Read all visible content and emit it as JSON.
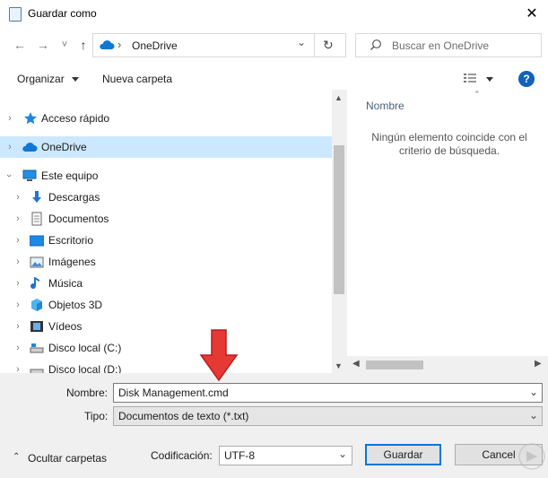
{
  "window": {
    "title": "Guardar como",
    "close_glyph": "✕"
  },
  "nav": {
    "back": "←",
    "forward": "→",
    "recent": "˅",
    "up": "↑",
    "refresh": "↻",
    "chevron": "›",
    "dropdown": "⌄"
  },
  "address": {
    "location": "OneDrive"
  },
  "search": {
    "placeholder": "Buscar en OneDrive"
  },
  "toolbar": {
    "organize": "Organizar",
    "new_folder": "Nueva carpeta",
    "help": "?"
  },
  "tree": [
    {
      "label": "Acceso rápido",
      "icon": "star-icon",
      "expandable": true,
      "indent": 0
    },
    {
      "label": "OneDrive",
      "icon": "cloud-icon",
      "expandable": true,
      "indent": 0,
      "selected": true
    },
    {
      "label": "Este equipo",
      "icon": "computer-icon",
      "expandable": true,
      "expanded": true,
      "indent": 0
    },
    {
      "label": "Descargas",
      "icon": "download-icon",
      "expandable": true,
      "indent": 1
    },
    {
      "label": "Documentos",
      "icon": "document-icon",
      "expandable": true,
      "indent": 1
    },
    {
      "label": "Escritorio",
      "icon": "desktop-icon",
      "expandable": true,
      "indent": 1
    },
    {
      "label": "Imágenes",
      "icon": "image-icon",
      "expandable": true,
      "indent": 1
    },
    {
      "label": "Música",
      "icon": "music-icon",
      "expandable": true,
      "indent": 1
    },
    {
      "label": "Objetos 3D",
      "icon": "cube-icon",
      "expandable": true,
      "indent": 1
    },
    {
      "label": "Vídeos",
      "icon": "video-icon",
      "expandable": true,
      "indent": 1
    },
    {
      "label": "Disco local (C:)",
      "icon": "drive-icon",
      "expandable": true,
      "indent": 1
    },
    {
      "label": "Disco local (D:)",
      "icon": "drive-icon",
      "expandable": true,
      "indent": 1
    }
  ],
  "content": {
    "column_name": "Nombre",
    "empty_message_line1": "Ningún elemento coincide con el",
    "empty_message_line2": "criterio de búsqueda."
  },
  "form": {
    "name_label": "Nombre:",
    "name_value": "Disk Management.cmd",
    "type_label": "Tipo:",
    "type_value": "Documentos de texto (*.txt)",
    "encoding_label": "Codificación:",
    "encoding_value": "UTF-8"
  },
  "footer": {
    "hide_folders": "Ocultar carpetas",
    "save": "Guardar",
    "cancel": "Cancel"
  },
  "colors": {
    "accent": "#0078d7",
    "selected_row": "#cce8ff",
    "arrow": "#e53935",
    "chrome": "#f0f0f0"
  }
}
